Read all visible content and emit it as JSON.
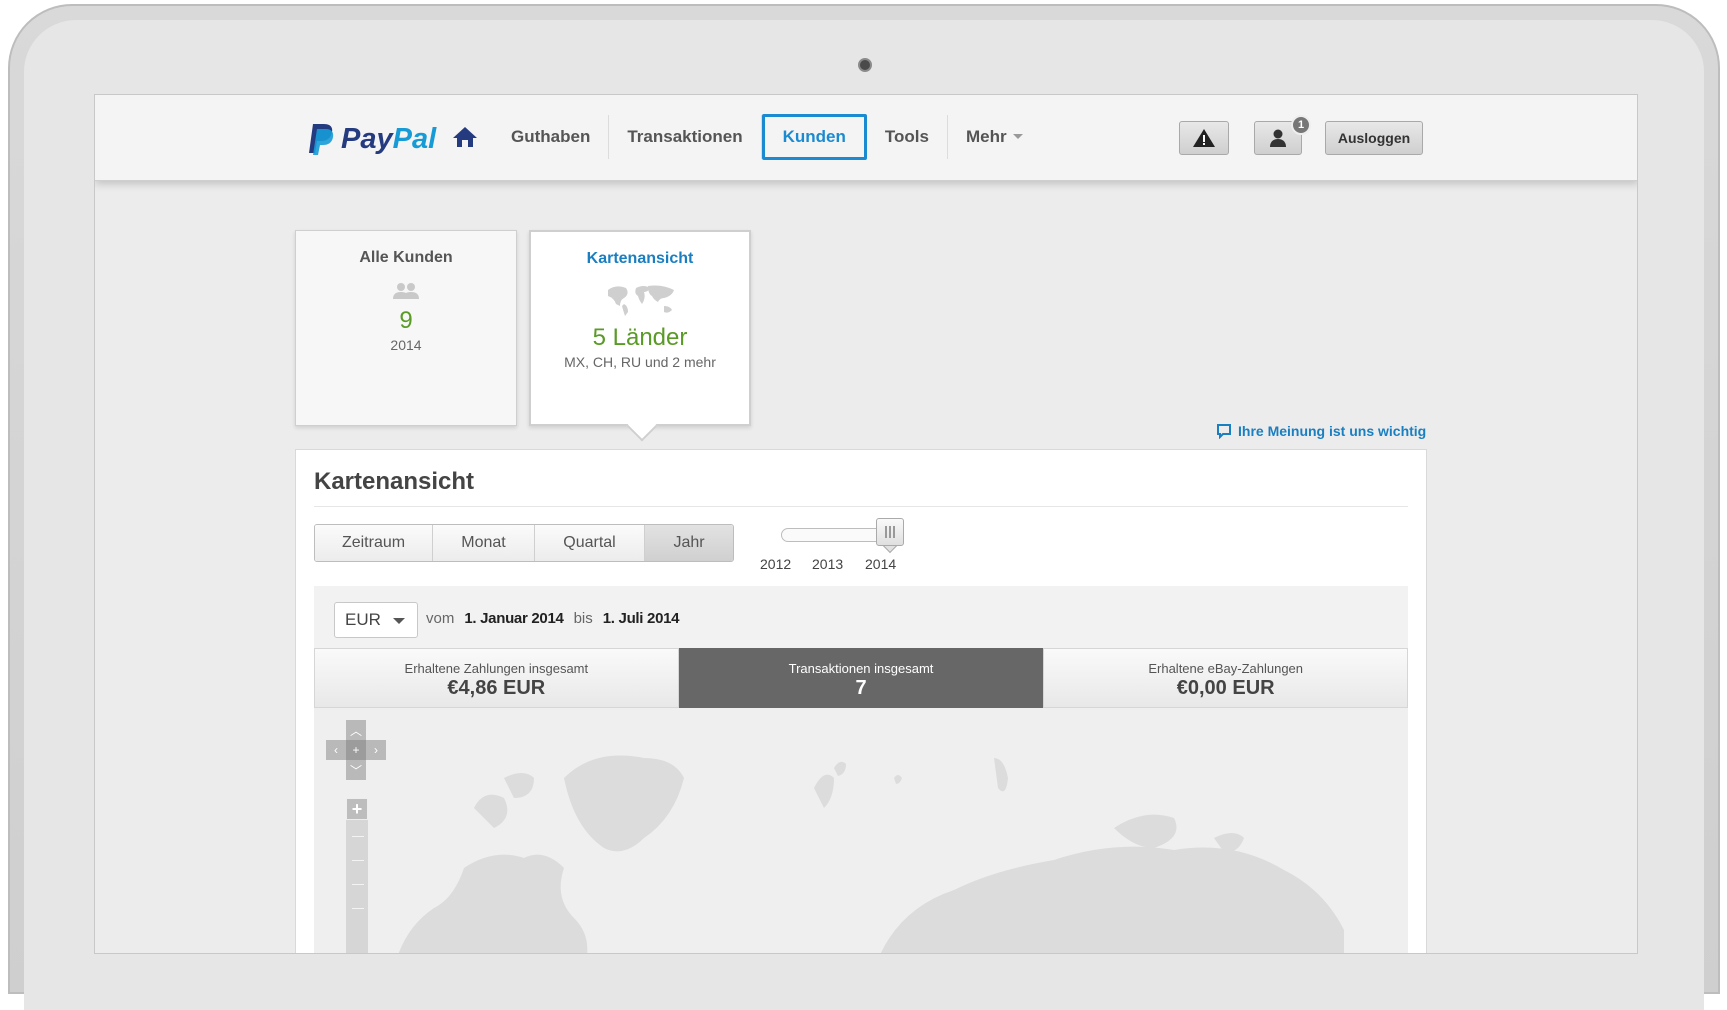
{
  "header": {
    "logo_text_pay": "Pay",
    "logo_text_pal": "Pal",
    "nav": [
      {
        "label": "Guthaben"
      },
      {
        "label": "Transaktionen"
      },
      {
        "label": "Kunden",
        "active": true
      },
      {
        "label": "Tools"
      },
      {
        "label": "Mehr",
        "dropdown": true
      }
    ],
    "notification_count": "1",
    "logout_label": "Ausloggen",
    "icons": [
      "home-icon",
      "alert-icon",
      "user-icon"
    ]
  },
  "cards": [
    {
      "title": "Alle Kunden",
      "value": "9",
      "sub": "2014",
      "icon": "customers-icon"
    },
    {
      "title": "Kartenansicht",
      "value": "5 Länder",
      "sub": "MX, CH, RU und 2 mehr",
      "icon": "world-map-icon",
      "selected": true
    }
  ],
  "feedback_label": "Ihre Meinung ist uns wichtig",
  "panel": {
    "title": "Kartenansicht",
    "periods": [
      {
        "label": "Zeitraum"
      },
      {
        "label": "Monat"
      },
      {
        "label": "Quartal"
      },
      {
        "label": "Jahr",
        "active": true
      }
    ],
    "years": [
      "2012",
      "2013",
      "2014"
    ],
    "selected_year": "2014",
    "currency": "EUR",
    "range_from_label": "vom",
    "range_from": "1. Januar 2014",
    "range_to_label": "bis",
    "range_to": "1. Juli 2014",
    "stats": [
      {
        "label": "Erhaltene Zahlungen insgesamt",
        "value": "€4,86 EUR"
      },
      {
        "label": "Transaktionen insgesamt",
        "value": "7",
        "active": true
      },
      {
        "label": "Erhaltene eBay-Zahlungen",
        "value": "€0,00 EUR"
      }
    ]
  },
  "colors": {
    "brand_dark": "#253b80",
    "brand_light": "#179bd7",
    "active_nav": "#1a8bd1",
    "value_green": "#5a9a27"
  }
}
